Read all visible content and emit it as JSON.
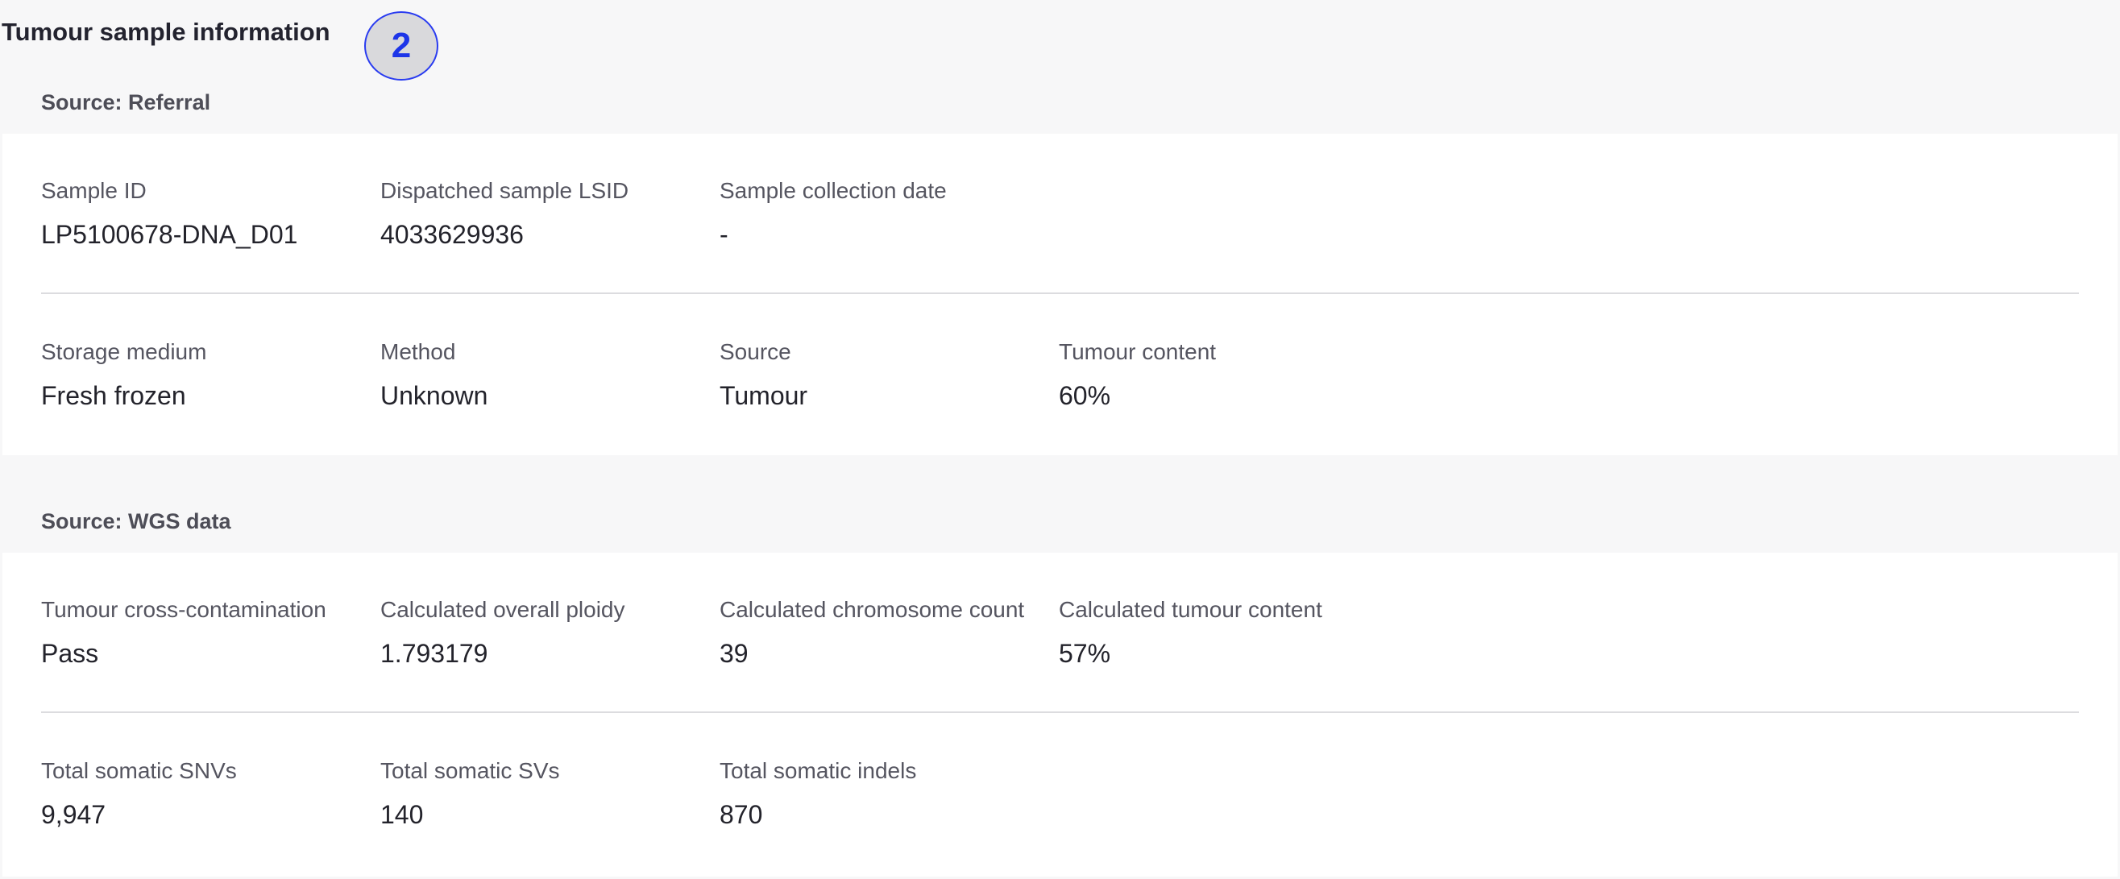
{
  "page": {
    "title": "Tumour sample information",
    "step_number": "2"
  },
  "referral": {
    "heading": "Source: Referral",
    "row1": [
      {
        "label": "Sample ID",
        "value": "LP5100678-DNA_D01"
      },
      {
        "label": "Dispatched sample LSID",
        "value": "4033629936"
      },
      {
        "label": "Sample collection date",
        "value": "-"
      }
    ],
    "row2": [
      {
        "label": "Storage medium",
        "value": "Fresh frozen"
      },
      {
        "label": "Method",
        "value": "Unknown"
      },
      {
        "label": "Source",
        "value": "Tumour"
      },
      {
        "label": "Tumour content",
        "value": "60%"
      }
    ]
  },
  "wgs": {
    "heading": "Source: WGS data",
    "row1": [
      {
        "label": "Tumour cross-contamination",
        "value": "Pass"
      },
      {
        "label": "Calculated overall ploidy",
        "value": "1.793179"
      },
      {
        "label": "Calculated chromosome count",
        "value": "39"
      },
      {
        "label": "Calculated tumour content",
        "value": "57%"
      }
    ],
    "row2": [
      {
        "label": "Total somatic SNVs",
        "value": "9,947"
      },
      {
        "label": "Total somatic SVs",
        "value": "140"
      },
      {
        "label": "Total somatic indels",
        "value": "870"
      }
    ]
  },
  "colors": {
    "background": "#f7f7f8",
    "card": "#ffffff",
    "badge_accent": "#1d35e8",
    "badge_fill": "#d9d9dc"
  }
}
